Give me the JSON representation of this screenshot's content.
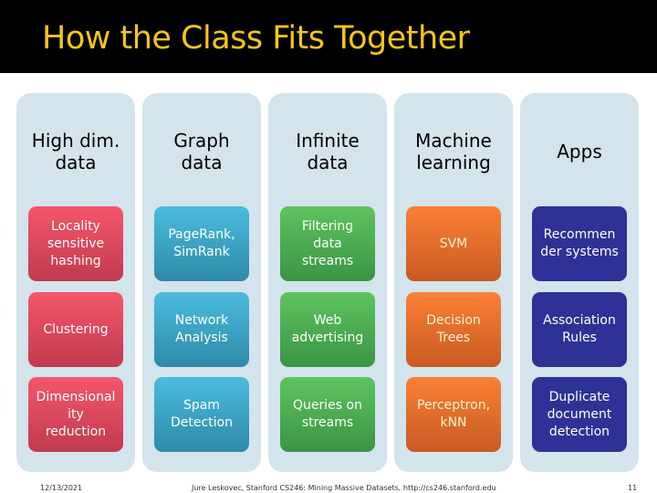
{
  "slide": {
    "title": "How the Class Fits Together",
    "colors": {
      "header_bg": "#000000",
      "title": "#f5c518",
      "column_bg": "#d3e4ec"
    }
  },
  "columns": [
    {
      "heading": "High dim.\ndata",
      "color": "red",
      "items": [
        "Locality\nsensitive\nhashing",
        "Clustering",
        "Dimensional\nity\nreduction"
      ]
    },
    {
      "heading": "Graph\ndata",
      "color": "blue",
      "items": [
        "PageRank,\nSimRank",
        "Network\nAnalysis",
        "Spam\nDetection"
      ]
    },
    {
      "heading": "Infinite\ndata",
      "color": "green",
      "items": [
        "Filtering\ndata\nstreams",
        "Web\nadvertising",
        "Queries on\nstreams"
      ]
    },
    {
      "heading": "Machine\nlearning",
      "color": "orange",
      "items": [
        "SVM",
        "Decision\nTrees",
        "Perceptron,\nkNN"
      ]
    },
    {
      "heading": "Apps",
      "color": "navy",
      "items": [
        "Recommen\nder systems",
        "Association\nRules",
        "Duplicate\ndocument\ndetection"
      ]
    }
  ],
  "footer": {
    "date": "12/13/2021",
    "credit": "Jure Leskovec, Stanford CS246: Mining Massive Datasets, http://cs246.stanford.edu",
    "page_number": "11"
  }
}
